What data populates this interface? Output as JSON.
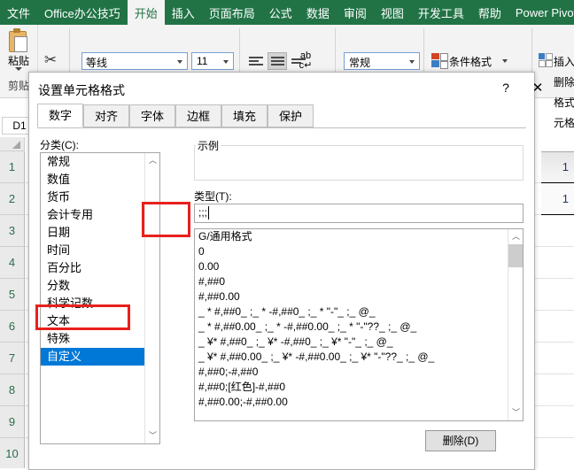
{
  "ribbon": {
    "tabs": [
      {
        "label": "文件",
        "active": false
      },
      {
        "label": "Office办公技巧",
        "active": false
      },
      {
        "label": "开始",
        "active": true
      },
      {
        "label": "插入",
        "active": false
      },
      {
        "label": "页面布局",
        "active": false
      },
      {
        "label": "公式",
        "active": false
      },
      {
        "label": "数据",
        "active": false
      },
      {
        "label": "审阅",
        "active": false
      },
      {
        "label": "视图",
        "active": false
      },
      {
        "label": "开发工具",
        "active": false
      },
      {
        "label": "帮助",
        "active": false
      },
      {
        "label": "Power Pivot",
        "active": false
      }
    ],
    "clipboard": {
      "paste_label": "粘贴",
      "group_label": "剪贴",
      "cut_icon": "✂"
    },
    "font": {
      "name": "等线",
      "size": "11"
    },
    "number": {
      "format": "常规"
    },
    "styles": {
      "conditional_format": "条件格式"
    },
    "cells": {
      "insert": "插入",
      "delete": "删除",
      "format": "格式",
      "group_label": "元格"
    }
  },
  "namebox": {
    "value": "D1"
  },
  "sheet": {
    "rows": [
      "1",
      "2",
      "3",
      "4",
      "5",
      "6",
      "7",
      "8",
      "9",
      "10"
    ],
    "cells": [
      {
        "row": "1",
        "value": "1"
      },
      {
        "row": "2",
        "value": "1"
      }
    ]
  },
  "dialog": {
    "title": "设置单元格格式",
    "help_glyph": "?",
    "close_glyph": "✕",
    "tabs": [
      {
        "label": "数字",
        "active": true
      },
      {
        "label": "对齐",
        "active": false
      },
      {
        "label": "字体",
        "active": false
      },
      {
        "label": "边框",
        "active": false
      },
      {
        "label": "填充",
        "active": false
      },
      {
        "label": "保护",
        "active": false
      }
    ],
    "category_label": "分类(C):",
    "categories": [
      {
        "label": "常规",
        "selected": false
      },
      {
        "label": "数值",
        "selected": false
      },
      {
        "label": "货币",
        "selected": false
      },
      {
        "label": "会计专用",
        "selected": false
      },
      {
        "label": "日期",
        "selected": false
      },
      {
        "label": "时间",
        "selected": false
      },
      {
        "label": "百分比",
        "selected": false
      },
      {
        "label": "分数",
        "selected": false
      },
      {
        "label": "科学记数",
        "selected": false
      },
      {
        "label": "文本",
        "selected": false
      },
      {
        "label": "特殊",
        "selected": false
      },
      {
        "label": "自定义",
        "selected": true
      }
    ],
    "sample_label": "示例",
    "sample_value": "",
    "type_label": "类型(T):",
    "type_value": ";;;",
    "format_list": [
      "G/通用格式",
      "0",
      "0.00",
      "#,##0",
      "#,##0.00",
      "_ * #,##0_ ;_ * -#,##0_ ;_ * \"-\"_ ;_ @_ ",
      "_ * #,##0.00_ ;_ * -#,##0.00_ ;_ * \"-\"??_ ;_ @_ ",
      "_ ¥* #,##0_ ;_ ¥* -#,##0_ ;_ ¥* \"-\"_ ;_ @_ ",
      "_ ¥* #,##0.00_ ;_ ¥* -#,##0.00_ ;_ ¥* \"-\"??_ ;_ @_ ",
      "#,##0;-#,##0",
      "#,##0;[红色]-#,##0",
      "#,##0.00;-#,##0.00"
    ],
    "delete_button": "删除(D)",
    "scroll_up_glyph": "︿",
    "scroll_down_glyph": "﹀"
  },
  "colors": {
    "ribbon_green": "#217346",
    "selection_blue": "#0078d7",
    "highlight_red": "#e8201c"
  }
}
